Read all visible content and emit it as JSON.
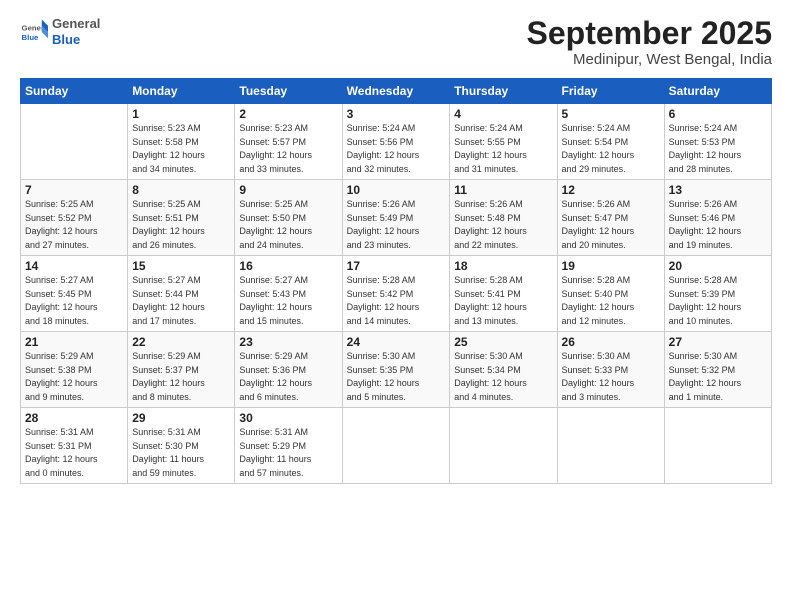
{
  "header": {
    "logo_general": "General",
    "logo_blue": "Blue",
    "month_title": "September 2025",
    "location": "Medinipur, West Bengal, India"
  },
  "days_of_week": [
    "Sunday",
    "Monday",
    "Tuesday",
    "Wednesday",
    "Thursday",
    "Friday",
    "Saturday"
  ],
  "weeks": [
    [
      {
        "day": "",
        "info": ""
      },
      {
        "day": "1",
        "info": "Sunrise: 5:23 AM\nSunset: 5:58 PM\nDaylight: 12 hours\nand 34 minutes."
      },
      {
        "day": "2",
        "info": "Sunrise: 5:23 AM\nSunset: 5:57 PM\nDaylight: 12 hours\nand 33 minutes."
      },
      {
        "day": "3",
        "info": "Sunrise: 5:24 AM\nSunset: 5:56 PM\nDaylight: 12 hours\nand 32 minutes."
      },
      {
        "day": "4",
        "info": "Sunrise: 5:24 AM\nSunset: 5:55 PM\nDaylight: 12 hours\nand 31 minutes."
      },
      {
        "day": "5",
        "info": "Sunrise: 5:24 AM\nSunset: 5:54 PM\nDaylight: 12 hours\nand 29 minutes."
      },
      {
        "day": "6",
        "info": "Sunrise: 5:24 AM\nSunset: 5:53 PM\nDaylight: 12 hours\nand 28 minutes."
      }
    ],
    [
      {
        "day": "7",
        "info": "Sunrise: 5:25 AM\nSunset: 5:52 PM\nDaylight: 12 hours\nand 27 minutes."
      },
      {
        "day": "8",
        "info": "Sunrise: 5:25 AM\nSunset: 5:51 PM\nDaylight: 12 hours\nand 26 minutes."
      },
      {
        "day": "9",
        "info": "Sunrise: 5:25 AM\nSunset: 5:50 PM\nDaylight: 12 hours\nand 24 minutes."
      },
      {
        "day": "10",
        "info": "Sunrise: 5:26 AM\nSunset: 5:49 PM\nDaylight: 12 hours\nand 23 minutes."
      },
      {
        "day": "11",
        "info": "Sunrise: 5:26 AM\nSunset: 5:48 PM\nDaylight: 12 hours\nand 22 minutes."
      },
      {
        "day": "12",
        "info": "Sunrise: 5:26 AM\nSunset: 5:47 PM\nDaylight: 12 hours\nand 20 minutes."
      },
      {
        "day": "13",
        "info": "Sunrise: 5:26 AM\nSunset: 5:46 PM\nDaylight: 12 hours\nand 19 minutes."
      }
    ],
    [
      {
        "day": "14",
        "info": "Sunrise: 5:27 AM\nSunset: 5:45 PM\nDaylight: 12 hours\nand 18 minutes."
      },
      {
        "day": "15",
        "info": "Sunrise: 5:27 AM\nSunset: 5:44 PM\nDaylight: 12 hours\nand 17 minutes."
      },
      {
        "day": "16",
        "info": "Sunrise: 5:27 AM\nSunset: 5:43 PM\nDaylight: 12 hours\nand 15 minutes."
      },
      {
        "day": "17",
        "info": "Sunrise: 5:28 AM\nSunset: 5:42 PM\nDaylight: 12 hours\nand 14 minutes."
      },
      {
        "day": "18",
        "info": "Sunrise: 5:28 AM\nSunset: 5:41 PM\nDaylight: 12 hours\nand 13 minutes."
      },
      {
        "day": "19",
        "info": "Sunrise: 5:28 AM\nSunset: 5:40 PM\nDaylight: 12 hours\nand 12 minutes."
      },
      {
        "day": "20",
        "info": "Sunrise: 5:28 AM\nSunset: 5:39 PM\nDaylight: 12 hours\nand 10 minutes."
      }
    ],
    [
      {
        "day": "21",
        "info": "Sunrise: 5:29 AM\nSunset: 5:38 PM\nDaylight: 12 hours\nand 9 minutes."
      },
      {
        "day": "22",
        "info": "Sunrise: 5:29 AM\nSunset: 5:37 PM\nDaylight: 12 hours\nand 8 minutes."
      },
      {
        "day": "23",
        "info": "Sunrise: 5:29 AM\nSunset: 5:36 PM\nDaylight: 12 hours\nand 6 minutes."
      },
      {
        "day": "24",
        "info": "Sunrise: 5:30 AM\nSunset: 5:35 PM\nDaylight: 12 hours\nand 5 minutes."
      },
      {
        "day": "25",
        "info": "Sunrise: 5:30 AM\nSunset: 5:34 PM\nDaylight: 12 hours\nand 4 minutes."
      },
      {
        "day": "26",
        "info": "Sunrise: 5:30 AM\nSunset: 5:33 PM\nDaylight: 12 hours\nand 3 minutes."
      },
      {
        "day": "27",
        "info": "Sunrise: 5:30 AM\nSunset: 5:32 PM\nDaylight: 12 hours\nand 1 minute."
      }
    ],
    [
      {
        "day": "28",
        "info": "Sunrise: 5:31 AM\nSunset: 5:31 PM\nDaylight: 12 hours\nand 0 minutes."
      },
      {
        "day": "29",
        "info": "Sunrise: 5:31 AM\nSunset: 5:30 PM\nDaylight: 11 hours\nand 59 minutes."
      },
      {
        "day": "30",
        "info": "Sunrise: 5:31 AM\nSunset: 5:29 PM\nDaylight: 11 hours\nand 57 minutes."
      },
      {
        "day": "",
        "info": ""
      },
      {
        "day": "",
        "info": ""
      },
      {
        "day": "",
        "info": ""
      },
      {
        "day": "",
        "info": ""
      }
    ]
  ]
}
